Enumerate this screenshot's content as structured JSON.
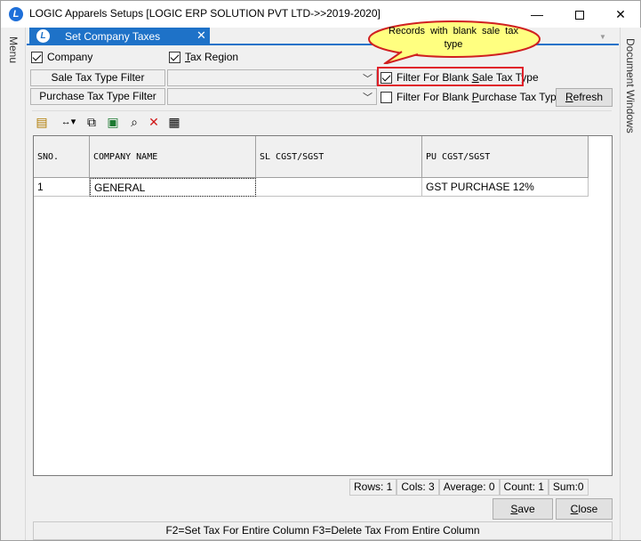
{
  "window": {
    "title": "LOGIC Apparels Setups  [LOGIC ERP SOLUTION PVT LTD->>2019-2020]",
    "app_icon": "logic-logo-icon",
    "controls": {
      "minimize": "—",
      "close": "✕"
    }
  },
  "side_panels": {
    "left": "Menu",
    "right": "Document Windows"
  },
  "tab": {
    "label": "Set Company Taxes",
    "close": "✕",
    "icon": "logic-logo-icon"
  },
  "options": {
    "company": {
      "label": "Company",
      "checked": true
    },
    "tax_region": {
      "label": "Tax Region",
      "label_underline": "T",
      "label_rest": "ax Region",
      "checked": true
    }
  },
  "filters": {
    "sale_tax_type_filter": {
      "label": "Sale Tax Type Filter",
      "value": ""
    },
    "purchase_tax_type_filter": {
      "label": "Purchase Tax Type Filter",
      "value": ""
    },
    "blank_sale": {
      "label_pre": "Filter For Blank ",
      "label_u": "S",
      "label_post": "ale Tax Type",
      "checked": true
    },
    "blank_purchase": {
      "label_pre": "Filter For Blank ",
      "label_u": "P",
      "label_post": "urchase Tax Type",
      "checked": false
    },
    "refresh": {
      "label_u": "R",
      "label_rest": "efresh"
    }
  },
  "callout": {
    "text": "Records with blank sale tax type",
    "fill": "#ffff80",
    "stroke": "#d02020"
  },
  "toolbar": [
    "export-icon",
    "column-resize-icon",
    "copy-icon",
    "excel-icon",
    "find-icon",
    "delete-icon",
    "grid-icon"
  ],
  "grid": {
    "columns": [
      "SNO.",
      "COMPANY NAME",
      "SL CGST/SGST",
      "PU CGST/SGST"
    ],
    "rows": [
      [
        "1",
        "GENERAL",
        "",
        "GST PURCHASE 12%"
      ]
    ]
  },
  "status": {
    "rows": "Rows: 1",
    "cols": "Cols: 3",
    "average": "Average: 0",
    "count": "Count: 1",
    "sum": "Sum:0"
  },
  "buttons": {
    "save": {
      "label_u": "S",
      "label_rest": "ave"
    },
    "close": {
      "label_u": "C",
      "label_rest": "lose"
    }
  },
  "footer": "F2=Set Tax For Entire Column  F3=Delete Tax From Entire Column",
  "colors": {
    "accent": "#1e72c8",
    "highlight": "#e0202a"
  }
}
